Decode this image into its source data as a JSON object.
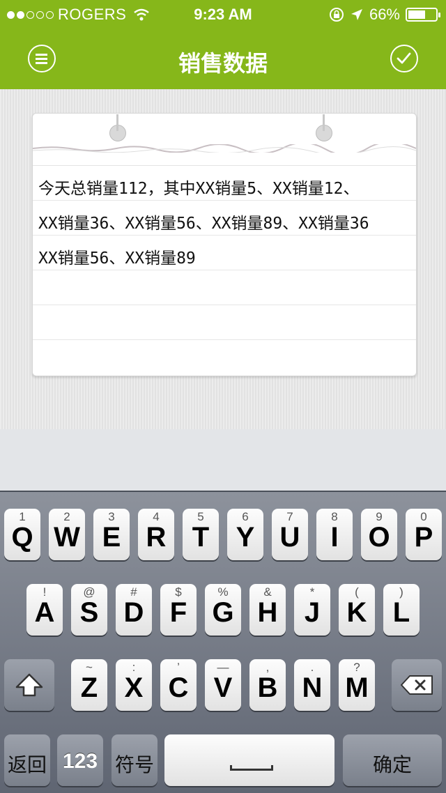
{
  "status_bar": {
    "carrier": "ROGERS",
    "time": "9:23 AM",
    "battery": "66%",
    "battery_level": 0.66
  },
  "nav": {
    "title": "销售数据",
    "left_icon": "menu-icon",
    "right_icon": "check-icon"
  },
  "note": {
    "lines": [
      "今天总销量112，其中XX销量5、XX销量12、",
      "XX销量36、XX销量56、XX销量89、XX销量36",
      "XX销量56、XX销量89",
      "",
      ""
    ]
  },
  "keyboard": {
    "row1": [
      {
        "hint": "1",
        "key": "Q"
      },
      {
        "hint": "2",
        "key": "W"
      },
      {
        "hint": "3",
        "key": "E"
      },
      {
        "hint": "4",
        "key": "R"
      },
      {
        "hint": "5",
        "key": "T"
      },
      {
        "hint": "6",
        "key": "Y"
      },
      {
        "hint": "7",
        "key": "U"
      },
      {
        "hint": "8",
        "key": "I"
      },
      {
        "hint": "9",
        "key": "O"
      },
      {
        "hint": "0",
        "key": "P"
      }
    ],
    "row2": [
      {
        "hint": "!",
        "key": "A"
      },
      {
        "hint": "@",
        "key": "S"
      },
      {
        "hint": "#",
        "key": "D"
      },
      {
        "hint": "$",
        "key": "F"
      },
      {
        "hint": "%",
        "key": "G"
      },
      {
        "hint": "&",
        "key": "H"
      },
      {
        "hint": "*",
        "key": "J"
      },
      {
        "hint": "(",
        "key": "K"
      },
      {
        "hint": ")",
        "key": "L"
      }
    ],
    "row3": [
      {
        "hint": "~",
        "key": "Z"
      },
      {
        "hint": ":",
        "key": "X"
      },
      {
        "hint": "’",
        "key": "C"
      },
      {
        "hint": "—",
        "key": "V"
      },
      {
        "hint": ",",
        "key": "B"
      },
      {
        "hint": ".",
        "key": "N"
      },
      {
        "hint": "?",
        "key": "M"
      }
    ],
    "back_label": "返回",
    "num_label": "123",
    "symbol_label": "符号",
    "confirm_label": "确定",
    "shift_icon": "shift-icon",
    "delete_icon": "delete-icon"
  }
}
